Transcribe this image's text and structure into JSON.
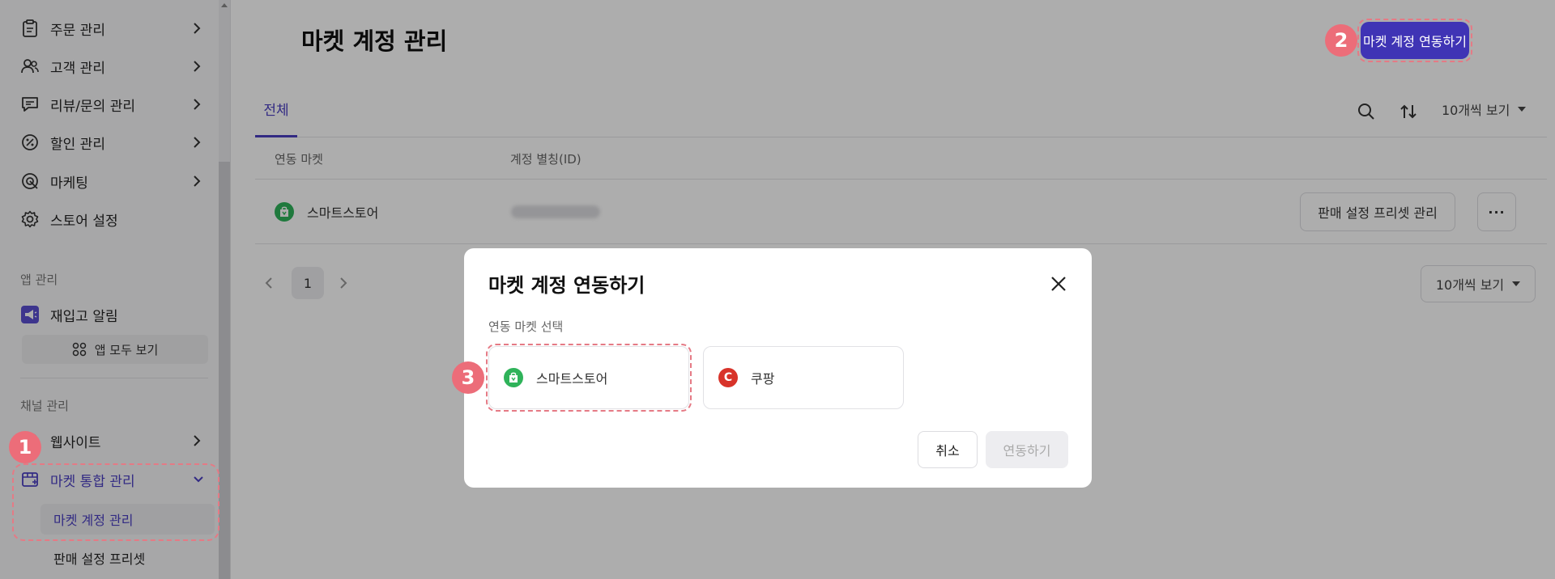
{
  "sidebar": {
    "items": [
      {
        "label": "주문 관리",
        "icon": "clipboard-icon"
      },
      {
        "label": "고객 관리",
        "icon": "users-icon"
      },
      {
        "label": "리뷰/문의 관리",
        "icon": "message-icon"
      },
      {
        "label": "할인 관리",
        "icon": "percent-icon"
      },
      {
        "label": "마케팅",
        "icon": "target-icon"
      },
      {
        "label": "스토어 설정",
        "icon": "gear-icon"
      }
    ],
    "app_section": "앱 관리",
    "app_item": "재입고 알림",
    "all_apps": "앱 모두 보기",
    "channel_section": "채널 관리",
    "website": "웹사이트",
    "market_integration": "마켓 통합 관리",
    "market_account": "마켓 계정 관리",
    "sales_preset": "판매 설정 프리셋"
  },
  "main": {
    "title": "마켓 계정 관리",
    "connect_button": "마켓 계정 연동하기",
    "tab_all": "전체",
    "per_page": "10개씩 보기",
    "columns": [
      "연동 마켓",
      "계정 별칭(ID)"
    ],
    "rows": [
      {
        "market": "스마트스토어",
        "preset_button": "판매 설정 프리셋 관리",
        "more": "···"
      }
    ],
    "page": "1"
  },
  "modal": {
    "title": "마켓 계정 연동하기",
    "label": "연동 마켓 선택",
    "markets": [
      "스마트스토어",
      "쿠팡"
    ],
    "coupang_letter": "C",
    "cancel": "취소",
    "connect": "연동하기"
  },
  "callouts": [
    "1",
    "2",
    "3"
  ],
  "colors": {
    "accent": "#3f34b5",
    "callout": "#ec6d79",
    "smartstore": "#2fb35a",
    "coupang": "#d8332a"
  }
}
